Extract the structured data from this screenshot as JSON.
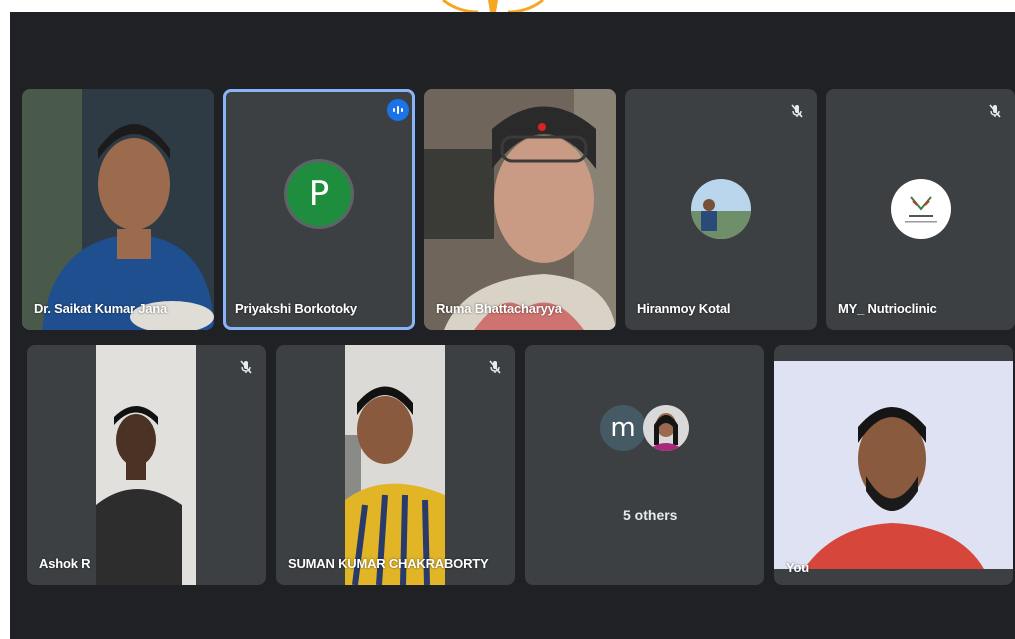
{
  "participants": [
    {
      "name": "Dr. Saikat Kumar Jana",
      "muted": false
    },
    {
      "name": "Priyakshi Borkotoky",
      "avatar_letter": "P",
      "avatar_color": "#1e8e3e",
      "speaking": true
    },
    {
      "name": "Ruma Bhattacharyya",
      "muted": false
    },
    {
      "name": "Hiranmoy Kotal",
      "muted": true
    },
    {
      "name": "MY_ Nutrioclinic",
      "muted": true
    },
    {
      "name": "Ashok R",
      "muted": true
    },
    {
      "name": "SUMAN KUMAR CHAKRABORTY",
      "muted": true
    },
    {
      "name": "You",
      "muted": false
    }
  ],
  "others": {
    "label": "5 others",
    "avatar_letter": "m",
    "avatar_color": "#455a64"
  },
  "colors": {
    "background": "#202124",
    "tile": "#3c4043",
    "accent": "#8ab4f8",
    "badge": "#1a73e8"
  },
  "icons": {
    "mute": "mic-off-icon",
    "speaking": "audio-level-icon"
  }
}
